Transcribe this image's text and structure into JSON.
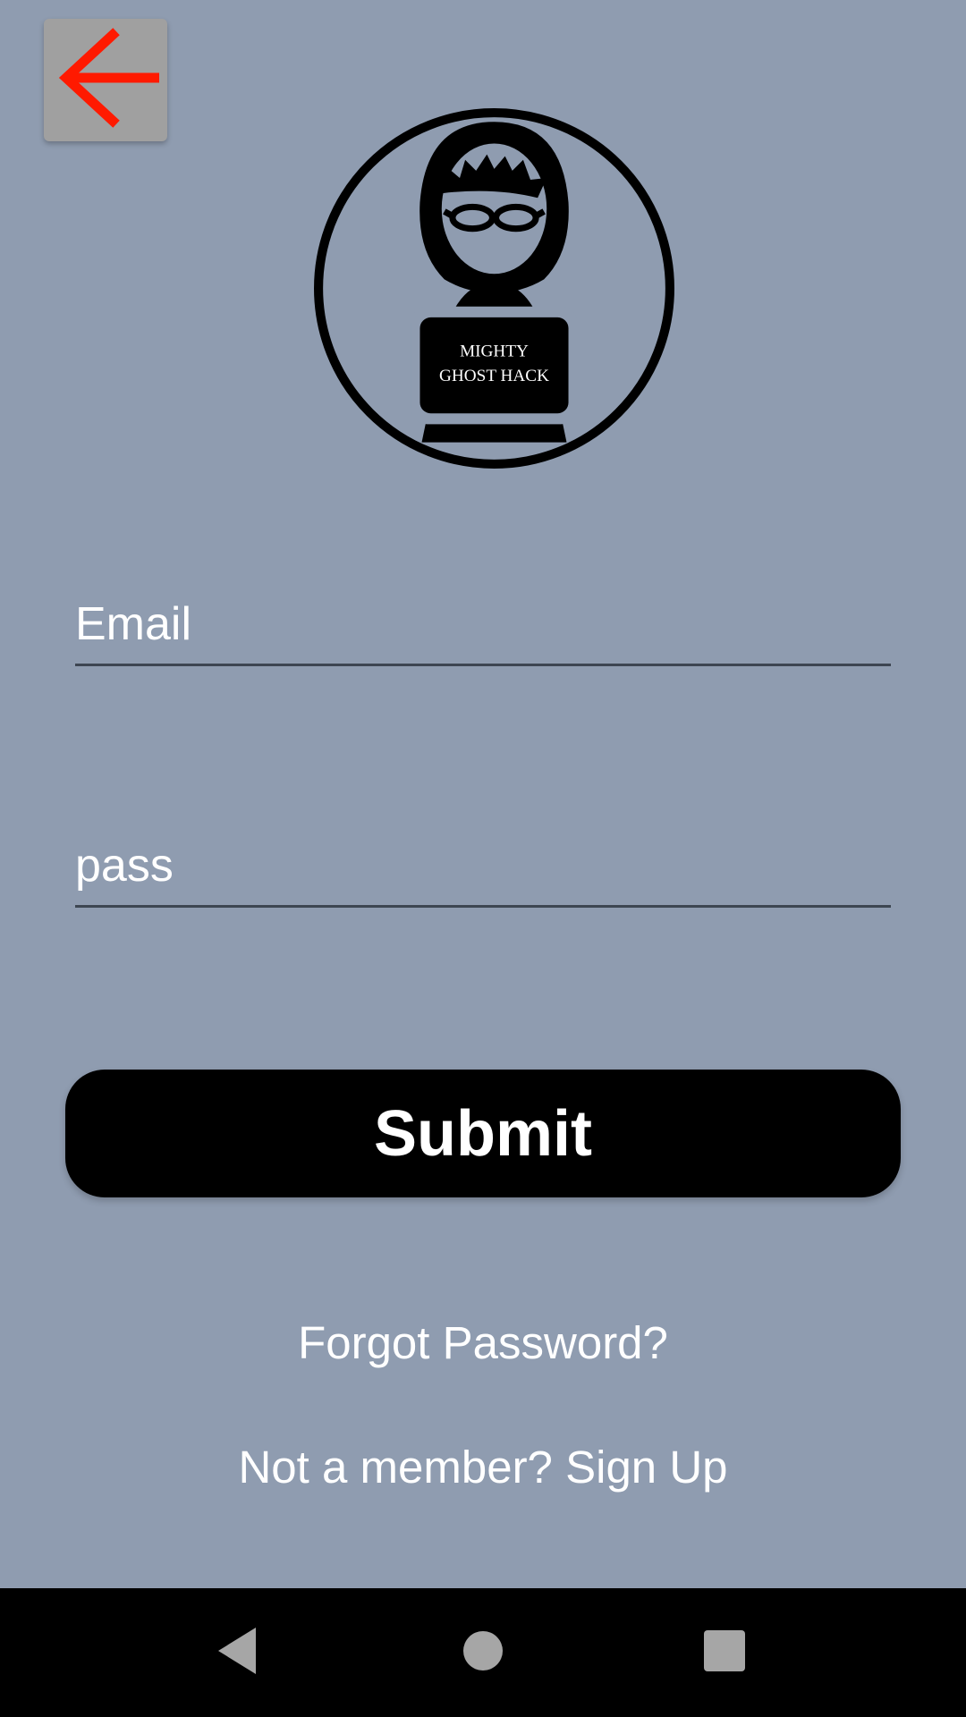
{
  "toolbar": {
    "back_icon": "arrow-left-icon",
    "back_icon_color": "#ff1a00"
  },
  "logo": {
    "line1": "MIGHTY",
    "line2": "GHOST HACK"
  },
  "form": {
    "email_placeholder": "Email",
    "password_placeholder": "pass",
    "submit_label": "Submit"
  },
  "links": {
    "forgot_password": "Forgot Password?",
    "sign_up": "Not a member? Sign Up"
  },
  "system_nav": {
    "back_icon": "triangle-back-icon",
    "home_icon": "circle-home-icon",
    "recents_icon": "square-recents-icon"
  },
  "colors": {
    "background": "#8f9cb0",
    "button": "#000000",
    "text": "#ffffff"
  }
}
